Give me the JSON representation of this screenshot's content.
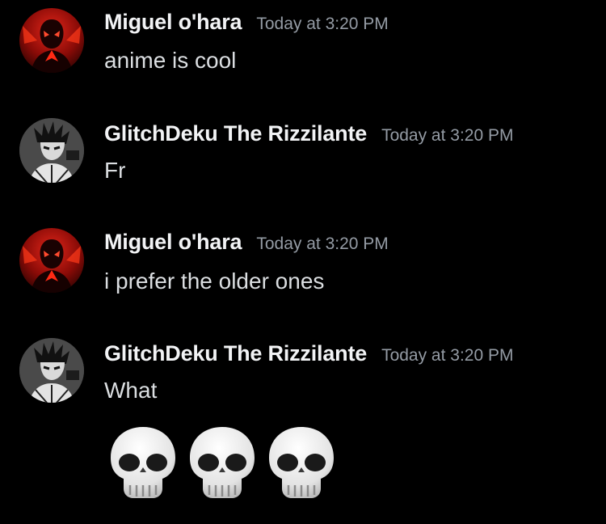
{
  "messages": [
    {
      "author": "Miguel o'hara",
      "timestamp": "Today at 3:20 PM",
      "text": "anime is cool",
      "avatar_icon": "spider-man-2099-avatar"
    },
    {
      "author": "GlitchDeku The Rizzilante",
      "timestamp": "Today at 3:20 PM",
      "text": "Fr",
      "avatar_icon": "deku-sketch-avatar"
    },
    {
      "author": "Miguel o'hara",
      "timestamp": "Today at 3:20 PM",
      "text": "i prefer the older ones",
      "avatar_icon": "spider-man-2099-avatar"
    },
    {
      "author": "GlitchDeku The Rizzilante",
      "timestamp": "Today at 3:20 PM",
      "text": "What",
      "avatar_icon": "deku-sketch-avatar"
    }
  ],
  "emoji_message": {
    "emojis": [
      "skull",
      "skull",
      "skull"
    ]
  },
  "colors": {
    "background": "#000000",
    "username": "#f2f3f5",
    "timestamp": "#949ba4",
    "message_text": "#dbdee1",
    "spider_red": "#c2150f"
  }
}
